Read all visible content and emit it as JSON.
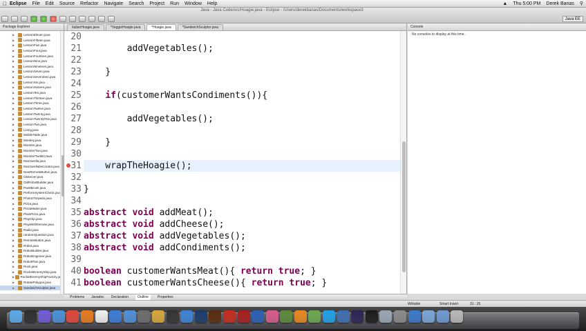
{
  "menubar": {
    "apple": "",
    "app_name": "Eclipse",
    "items": [
      "File",
      "Edit",
      "Source",
      "Refactor",
      "Navigate",
      "Search",
      "Project",
      "Run",
      "Window",
      "Help"
    ],
    "clock": "Thu 5:00 PM",
    "user": "Derek Banas"
  },
  "window": {
    "title": "Java - Java Code/src/Hoagie.java - Eclipse - /Users/derekbanas/Documents/workspace3",
    "perspective": "Java EE"
  },
  "package_explorer": {
    "title": "Package Explorer",
    "items": [
      "LessonEleven.java",
      "LessonFifteen.java",
      "LessonFive.java",
      "LessonFour.java",
      "LessonFourteen.java",
      "LessonNine.java",
      "LessonNineteen.java",
      "LessonSeven.java",
      "LessonSeventeen.java",
      "LessonSix.java",
      "LessonSixteen.java",
      "LessonTen.java",
      "LessonThirteen.java",
      "LessonThree.java",
      "LessonTwelve.java",
      "LessonTwenty.java",
      "LessonTwentyOne.java",
      "LessonTwo.java",
      "Living.java",
      "MobileTable.java",
      "Monkey.java",
      "Monster.java",
      "MonsterTwo.java",
      "MonsterTwoBUJava",
      "Mozzarella.java",
      "MozzarellaDecorator.java",
      "NewRemoteButton.java",
      "Observer.java",
      "OldRobotBuilder.java",
      "PaintBrush.java",
      "PerformSystemCheck.java",
      "PhotonTorpedo.java",
      "Pizza.java",
      "PizzaMaker.java",
      "PlainPizza.java",
      "PlayClip.java",
      "PlayWithRemote.java",
      "Radio.java",
      "randomQuestion.java",
      "RemoteButton.java",
      "Robot.java",
      "RobotBuilder.java",
      "RobotEngineer.java",
      "RobotPlan.java",
      "Rock.java",
      "RocketEnemyShip.java",
      "RocketEnemyShipFactory.java",
      "RotatePolygon.java",
      "SandwichSculptor.java"
    ],
    "selected_index": 48
  },
  "editor": {
    "tabs": [
      "ItalianHoagie.java",
      "*VeggieHoagie.java",
      "*Hoagie.java",
      "*SandwichSculptor.java"
    ],
    "active_tab": 2,
    "lines": [
      {
        "n": "20",
        "text": ""
      },
      {
        "n": "21",
        "text": "        addVegetables();"
      },
      {
        "n": "22",
        "text": ""
      },
      {
        "n": "23",
        "text": "    }"
      },
      {
        "n": "24",
        "text": ""
      },
      {
        "n": "25",
        "pre": "    ",
        "kw": "if",
        "text": "(customerWantsCondiments()){"
      },
      {
        "n": "26",
        "text": ""
      },
      {
        "n": "27",
        "text": "        addVegetables();"
      },
      {
        "n": "28",
        "text": ""
      },
      {
        "n": "29",
        "text": "    }"
      },
      {
        "n": "30",
        "text": ""
      },
      {
        "n": "31",
        "text": "    wrapTheHoagie();"
      },
      {
        "n": "32",
        "text": ""
      },
      {
        "n": "33",
        "text": "}"
      },
      {
        "n": "34",
        "text": ""
      },
      {
        "n": "35",
        "kw": "abstract void",
        "text": " addMeat();"
      },
      {
        "n": "36",
        "kw": "abstract void",
        "text": " addCheese();"
      },
      {
        "n": "37",
        "kw": "abstract void",
        "text": " addVegetables();"
      },
      {
        "n": "38",
        "kw": "abstract void",
        "text": " addCondiments();"
      },
      {
        "n": "39",
        "text": ""
      },
      {
        "n": "40",
        "kw": "boolean",
        "text": " customerWantsMeat(){ ",
        "kw2": "return true",
        "tail": "; }"
      },
      {
        "n": "41",
        "kw": "boolean",
        "text": " customerWantsCheese(){ ",
        "kw2": "return true",
        "tail": "; }"
      }
    ],
    "highlight_line": "31"
  },
  "console": {
    "title": "Console",
    "message": "No consoles to display at this time."
  },
  "bottom_tabs": [
    "Problems",
    "Javadoc",
    "Declaration",
    "Outline",
    "Properties"
  ],
  "bottom_active": 3,
  "status": {
    "writable": "Writable",
    "insert_mode": "Smart Insert",
    "position": "31 : 25"
  },
  "colors": {
    "keyword": "#7f0055",
    "line_highlight": "#e8f2fe",
    "error_marker": "#e34a3b"
  },
  "dock": {
    "icons": [
      {
        "name": "finder-icon",
        "color": "#5aa9e6"
      },
      {
        "name": "dashboard-icon",
        "color": "#2d2d2d"
      },
      {
        "name": "mission-control-icon",
        "color": "#6f5ad6"
      },
      {
        "name": "safari-icon",
        "color": "#4a90d9"
      },
      {
        "name": "chrome-icon",
        "color": "#e0463a"
      },
      {
        "name": "firefox-icon",
        "color": "#e87a1e"
      },
      {
        "name": "calendar-icon",
        "color": "#f0f0f0"
      },
      {
        "name": "itunes-icon",
        "color": "#3a7bd5"
      },
      {
        "name": "iphoto-icon",
        "color": "#4f8fd6"
      },
      {
        "name": "imovie-icon",
        "color": "#6c6c6c"
      },
      {
        "name": "garageband-icon",
        "color": "#d6a73b"
      },
      {
        "name": "cinema-icon",
        "color": "#333333"
      },
      {
        "name": "app-store-icon",
        "color": "#3b83d6"
      },
      {
        "name": "photoshop-icon",
        "color": "#1b3a6b"
      },
      {
        "name": "illustrator-icon",
        "color": "#5b2a0b"
      },
      {
        "name": "acrobat-icon",
        "color": "#c42b1c"
      },
      {
        "name": "flash-icon",
        "color": "#a61d1d"
      },
      {
        "name": "word-icon",
        "color": "#2b5fb4"
      },
      {
        "name": "paint-icon",
        "color": "#d65a8a"
      },
      {
        "name": "minecraft-icon",
        "color": "#5a8a3a"
      },
      {
        "name": "vlc-icon",
        "color": "#e8871e"
      },
      {
        "name": "camtasia-icon",
        "color": "#6aa84f"
      },
      {
        "name": "skype-icon",
        "color": "#1ea1e6"
      },
      {
        "name": "wireshark-icon",
        "color": "#3f6db0"
      },
      {
        "name": "eclipse-icon",
        "color": "#2c2255"
      },
      {
        "name": "terminal-icon",
        "color": "#1a1a1a"
      },
      {
        "name": "preview-icon",
        "color": "#9aa7b3"
      },
      {
        "name": "keychain-icon",
        "color": "#8a8a8a"
      },
      {
        "name": "downloads-icon",
        "color": "#3a78c8"
      },
      {
        "name": "documents-icon",
        "color": "#7aa6d8"
      },
      {
        "name": "folder-icon",
        "color": "#6e9ad0"
      },
      {
        "name": "trash-icon",
        "color": "#b8b8b8"
      }
    ]
  }
}
